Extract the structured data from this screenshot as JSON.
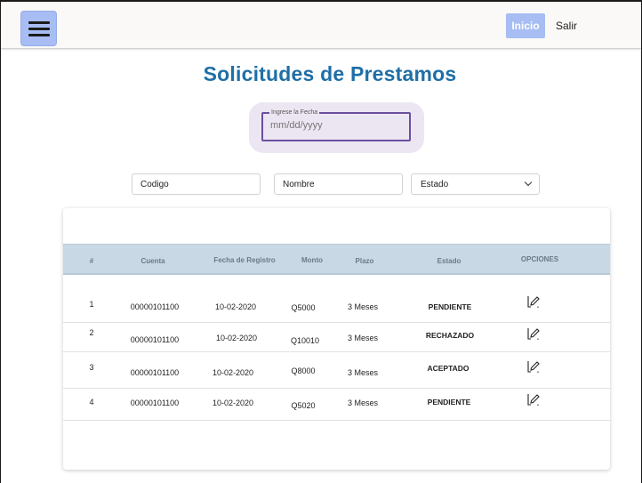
{
  "header": {
    "menu_icon": "hamburger-menu-icon",
    "nav": {
      "inicio": "Inicio",
      "salir": "Salir"
    }
  },
  "page": {
    "title": "Solicitudes de Prestamos"
  },
  "date_filter": {
    "label": "Ingrese la Fecha",
    "placeholder": "mm/dd/yyyy"
  },
  "filters": {
    "codigo_placeholder": "Codigo",
    "nombre_placeholder": "Nombre",
    "estado_value": "Estado"
  },
  "table": {
    "columns": [
      "#",
      "Cuenta",
      "Fecha de Registro",
      "Monto",
      "Plazo",
      "Estado",
      "OPCIONES"
    ],
    "rows": [
      {
        "num": "1",
        "cuenta": "00000101100",
        "fecha": "10-02-2020",
        "monto": "Q5000",
        "plazo": "3 Meses",
        "estado": "PENDIENTE",
        "opcion_icon": "edit-icon"
      },
      {
        "num": "2",
        "cuenta": "00000101100",
        "fecha": "10-02-2020",
        "monto": "Q10010",
        "plazo": "3 Meses",
        "estado": "RECHAZADO",
        "opcion_icon": "edit-icon"
      },
      {
        "num": "3",
        "cuenta": "00000101100",
        "fecha": "10-02-2020",
        "monto": "Q8000",
        "plazo": "3 Meses",
        "estado": "ACEPTADO",
        "opcion_icon": "edit-icon"
      },
      {
        "num": "4",
        "cuenta": "00000101100",
        "fecha": "10-02-2020",
        "monto": "Q5020",
        "plazo": "3 Meses",
        "estado": "PENDIENTE",
        "opcion_icon": "edit-icon"
      }
    ]
  },
  "colors": {
    "primary_title": "#1f6fa6",
    "nav_accent": "#a7bdf3",
    "table_header_bg": "#c8d8e4",
    "date_field_border": "#6b4fa0"
  }
}
